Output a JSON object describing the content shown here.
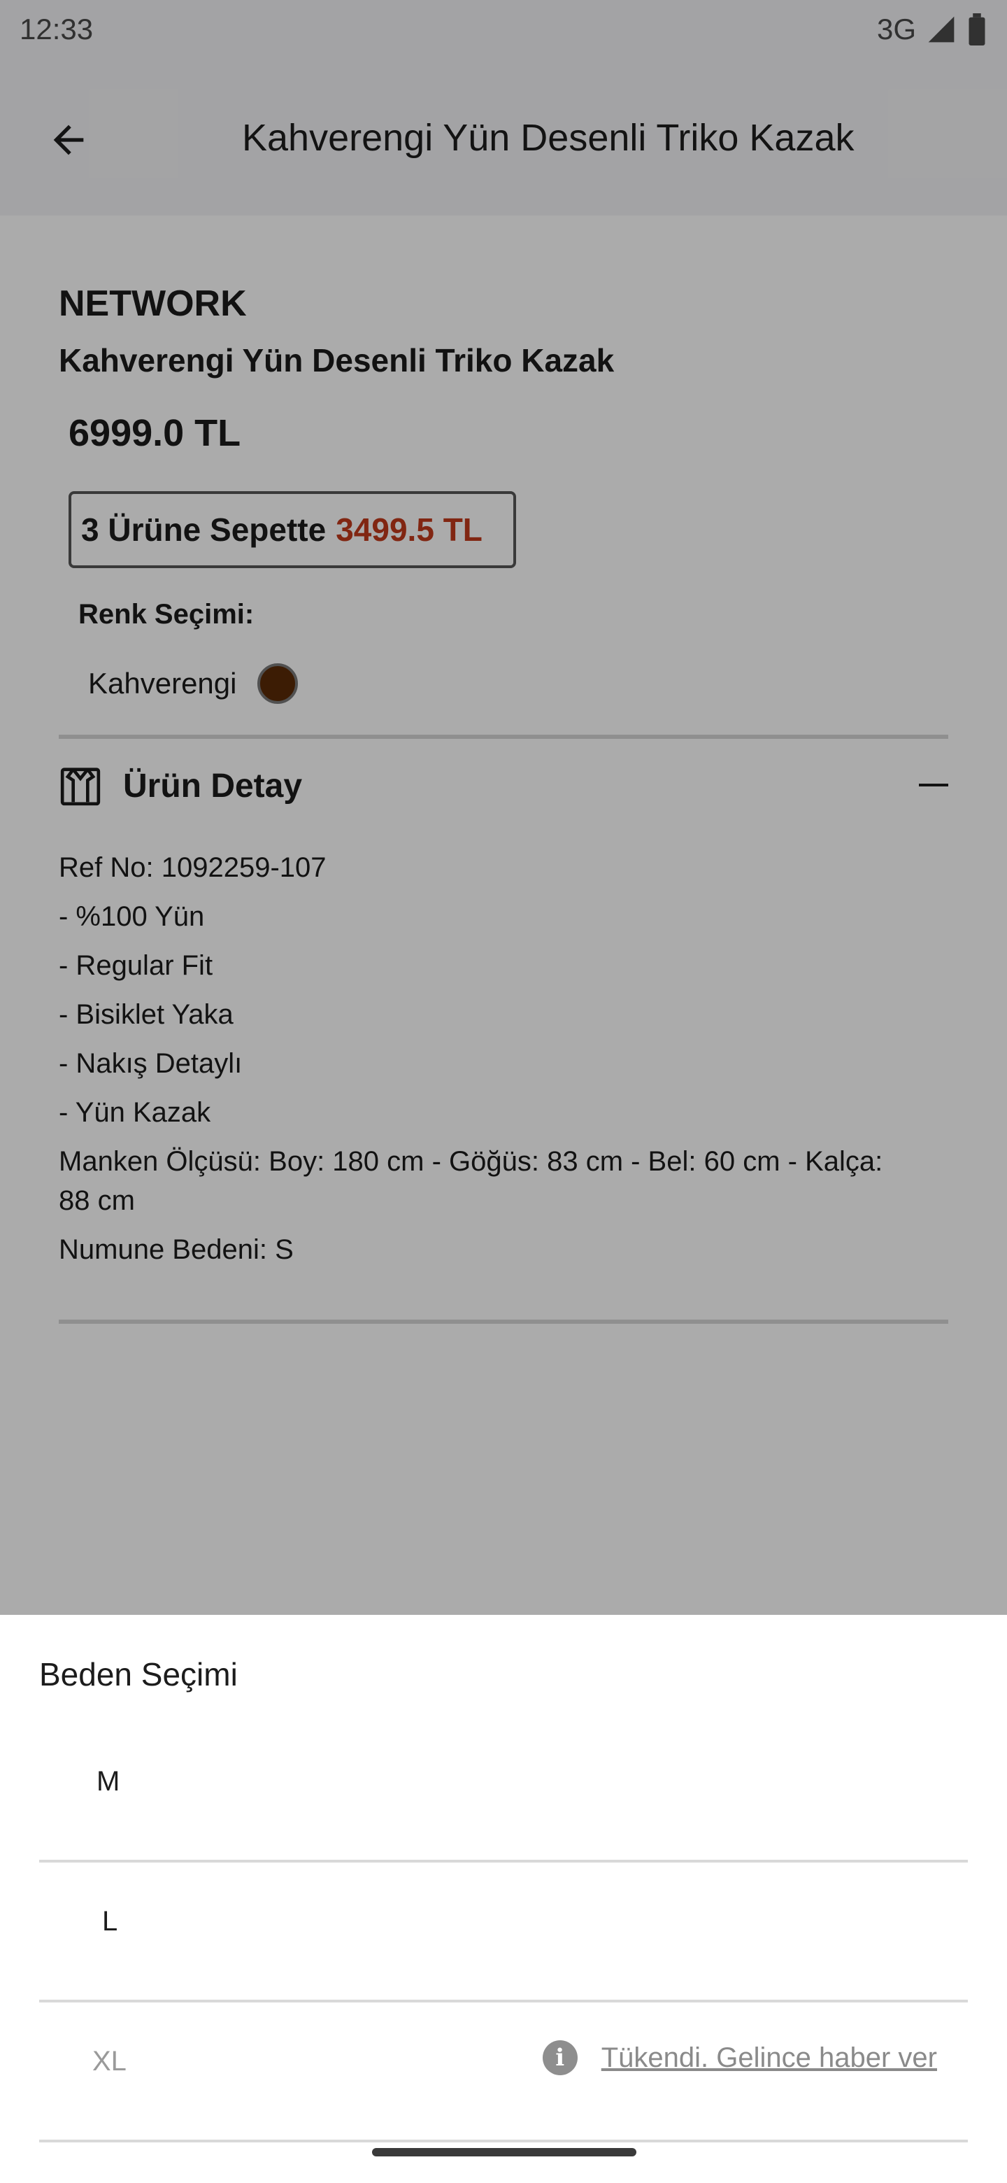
{
  "status_bar": {
    "time": "12:33",
    "network": "3G"
  },
  "app_bar": {
    "title": "Kahverengi Yün Desenli Triko Kazak"
  },
  "product": {
    "brand": "NETWORK",
    "name": "Kahverengi Yün Desenli Triko Kazak",
    "price": "6999.0 TL",
    "promo": {
      "label": "3 Ürüne Sepette",
      "price": "3499.5 TL"
    },
    "color_label": "Renk Seçimi:",
    "color_name": "Kahverengi",
    "color_hex": "#5a2a06"
  },
  "details": {
    "title": "Ürün Detay",
    "lines": [
      "Ref No: 1092259-107",
      "- %100 Yün",
      "- Regular Fit",
      "-  Bisiklet Yaka",
      "-  Nakış Detaylı",
      "-  Yün Kazak",
      "Manken Ölçüsü: Boy: 180 cm - Göğüs: 83 cm - Bel: 60 cm - Kalça: 88 cm",
      "Numune Bedeni: S"
    ]
  },
  "size_sheet": {
    "title": "Beden Seçimi",
    "sizes": [
      {
        "label": "M",
        "available": true
      },
      {
        "label": "L",
        "available": true
      },
      {
        "label": "XL",
        "available": false,
        "notice": "Tükendi. Gelince haber ver"
      }
    ]
  }
}
